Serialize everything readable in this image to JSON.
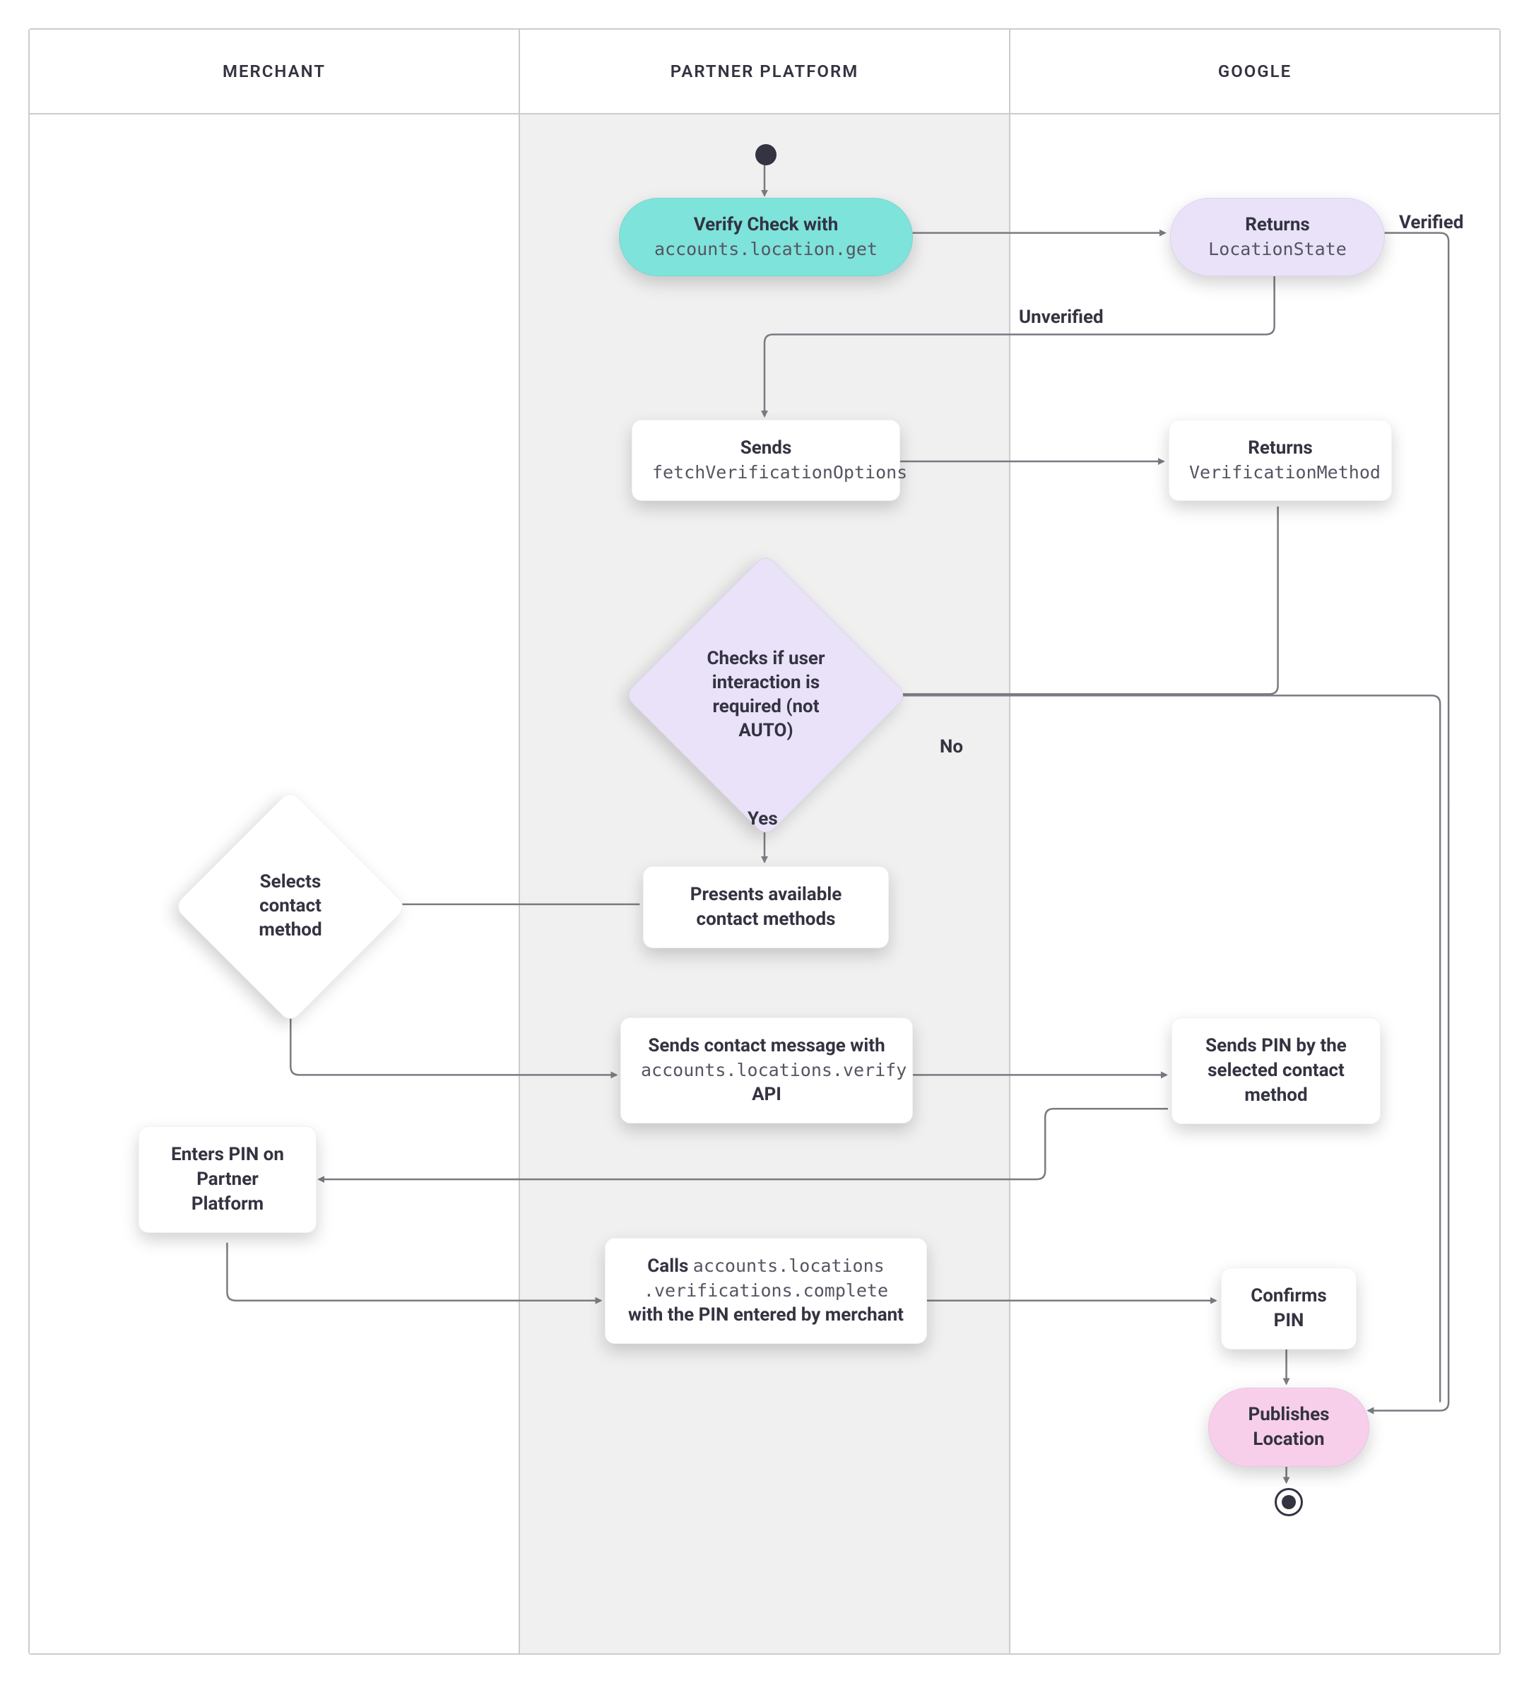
{
  "lanes": {
    "merchant": "MERCHANT",
    "partner": "PARTNER PLATFORM",
    "google": "GOOGLE"
  },
  "nodes": {
    "verifyCheck": {
      "line1": "Verify Check with",
      "line2": "accounts.location.get"
    },
    "returnsLocationState": {
      "line1": "Returns",
      "line2": "LocationState"
    },
    "sendsFetch": {
      "line1": "Sends",
      "line2": "fetchVerificationOptions"
    },
    "returnsVerificationMethod": {
      "line1": "Returns",
      "line2": "VerificationMethod"
    },
    "checksInteraction": "Checks if user interaction is required (not AUTO)",
    "presentsMethods": "Presents available contact methods",
    "selectsContact": "Selects contact method",
    "sendsContactMsg": {
      "line1": "Sends contact message with",
      "line2": "accounts.locations.verify",
      "line3": "API"
    },
    "sendsPin": "Sends PIN by the selected contact method",
    "entersPin": "Enters PIN on Partner Platform",
    "callsComplete": {
      "line1a": "Calls ",
      "line1b": "accounts.locations",
      "line2": ".verifications.complete",
      "line3": "with the PIN entered by merchant"
    },
    "confirmsPin": "Confirms PIN",
    "publishesLocation": "Publishes Location"
  },
  "edges": {
    "verified": "Verified",
    "unverified": "Unverified",
    "yes": "Yes",
    "no": "No"
  }
}
